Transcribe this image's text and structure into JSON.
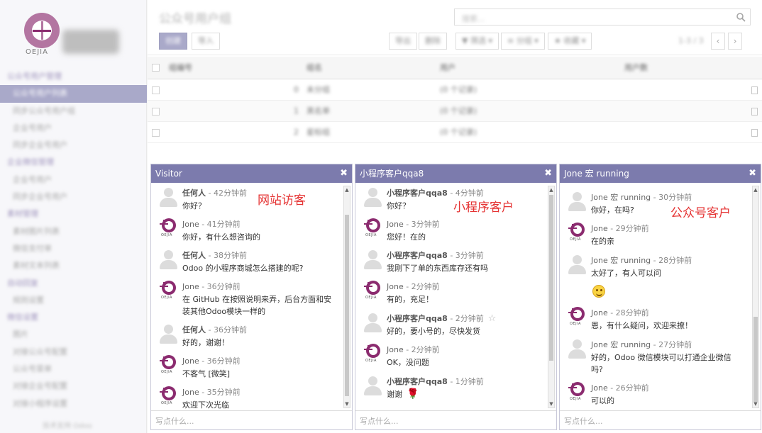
{
  "sidebar": {
    "logo_text": "OEJIA",
    "items": [
      {
        "label": "公众号用户管理",
        "type": "section"
      },
      {
        "label": "公众号用户列表",
        "type": "sub",
        "active": true
      },
      {
        "label": "同步公众号用户组",
        "type": "sub"
      },
      {
        "label": "企业号用户",
        "type": "sub"
      },
      {
        "label": "同步企业号用户",
        "type": "sub"
      },
      {
        "label": "企业微信管理",
        "type": "section"
      },
      {
        "label": "企业号用户",
        "type": "sub"
      },
      {
        "label": "同步企业号用户",
        "type": "sub"
      },
      {
        "label": "素材管理",
        "type": "section"
      },
      {
        "label": "素材图片列表",
        "type": "sub"
      },
      {
        "label": "微信支付单",
        "type": "sub"
      },
      {
        "label": "素材文本列表",
        "type": "sub"
      },
      {
        "label": "自动回复",
        "type": "section"
      },
      {
        "label": "规则设置",
        "type": "sub"
      },
      {
        "label": "微信设置",
        "type": "section"
      },
      {
        "label": "图片",
        "type": "sub"
      },
      {
        "label": "对接公众号配置",
        "type": "sub"
      },
      {
        "label": "公众号菜单",
        "type": "sub"
      },
      {
        "label": "对接企业号配置",
        "type": "sub"
      },
      {
        "label": "对接小程序设置",
        "type": "sub"
      }
    ],
    "powered": "技术支持 Odoo"
  },
  "control_panel": {
    "breadcrumb": "公众号用户组",
    "search_placeholder": "搜索...",
    "create_label": "创建",
    "import_label": "导入",
    "buttons": [
      "导出",
      "删除",
      "▼ 筛选 ▾",
      "≡ 分组 ▾",
      "★ 收藏 ▾"
    ],
    "pager": "1-3 / 3"
  },
  "table": {
    "headers": [
      "组编号",
      "组名",
      "用户",
      "用户数"
    ],
    "rows": [
      {
        "id": "0",
        "name": "未分组",
        "user": "(0 个记录)"
      },
      {
        "id": "1",
        "name": "黑名单",
        "user": "(0 个记录)"
      },
      {
        "id": "2",
        "name": "星标组",
        "user": "(0 个记录)"
      }
    ]
  },
  "chats": [
    {
      "title": "Visitor",
      "annotation": "网站访客",
      "input_placeholder": "写点什么...",
      "messages": [
        {
          "author": "任何人",
          "time": " - 42分钟前",
          "text": "你好？",
          "avatar": "anon"
        },
        {
          "author": "Jone",
          "time": " - 41分钟前",
          "text": "你好，有什么想咨询的",
          "avatar": "oejia"
        },
        {
          "author": "任何人",
          "time": " - 38分钟前",
          "text": "Odoo 的小程序商城怎么搭建的呢?",
          "avatar": "anon"
        },
        {
          "author": "Jone",
          "time": " - 36分钟前",
          "text": "在 GitHub 在按照说明来弄，后台方面和安装其他Odoo模块一样的",
          "avatar": "oejia"
        },
        {
          "author": "任何人",
          "time": " - 36分钟前",
          "text": "好的，谢谢！",
          "avatar": "anon"
        },
        {
          "author": "Jone",
          "time": " - 36分钟前",
          "text": "不客气 [微笑]",
          "avatar": "oejia"
        },
        {
          "author": "Jone",
          "time": " - 35分钟前",
          "text": "欢迎下次光临",
          "avatar": "oejia"
        }
      ]
    },
    {
      "title": "小程序客户qqa8",
      "annotation": "小程序客户",
      "input_placeholder": "写点什么...",
      "messages": [
        {
          "author": "小程序客户qqa8",
          "time": " - 4分钟前",
          "text": "你好？",
          "avatar": "anon"
        },
        {
          "author": "Jone",
          "time": " - 3分钟前",
          "text": "您好！在的",
          "avatar": "oejia"
        },
        {
          "author": "小程序客户qqa8",
          "time": " - 3分钟前",
          "text": "我刚下了单的东西库存还有吗",
          "avatar": "anon"
        },
        {
          "author": "Jone",
          "time": " - 2分钟前",
          "text": "有的，充足！",
          "avatar": "oejia"
        },
        {
          "author": "小程序客户qqa8",
          "time": " - 2分钟前",
          "text": "好的，要小号的，尽快发货",
          "avatar": "anon"
        },
        {
          "author": "Jone",
          "time": " - 2分钟前",
          "text": "OK，没问题",
          "avatar": "oejia"
        },
        {
          "author": "小程序客户qqa8",
          "time": " - 1分钟前",
          "text": "谢谢",
          "avatar": "anon"
        }
      ]
    },
    {
      "title": "Jone 宏 running",
      "annotation": "公众号客户",
      "input_placeholder": "写点什么...",
      "messages": [
        {
          "author": "Jone 宏 running",
          "time": " - 30分钟前",
          "text": "你好，在吗?",
          "avatar": "anon"
        },
        {
          "author": "Jone",
          "time": " - 29分钟前",
          "text": "在的亲",
          "avatar": "oejia"
        },
        {
          "author": "Jone 宏 running",
          "time": " - 28分钟前",
          "text": "太好了，有人可以问",
          "avatar": "anon"
        },
        {
          "author": "Jone",
          "time": " - 28分钟前",
          "text": "恩，有什么疑问，欢迎来撩！",
          "avatar": "oejia"
        },
        {
          "author": "Jone 宏 running",
          "time": " - 27分钟前",
          "text": "好的，Odoo 微信模块可以打通企业微信吗?",
          "avatar": "anon"
        },
        {
          "author": "Jone",
          "time": " - 26分钟前",
          "text": "可以的",
          "avatar": "oejia"
        }
      ]
    }
  ],
  "colors": {
    "accent": "#7c7bad",
    "brand": "#8b2b6f",
    "annotation": "#e53333"
  }
}
